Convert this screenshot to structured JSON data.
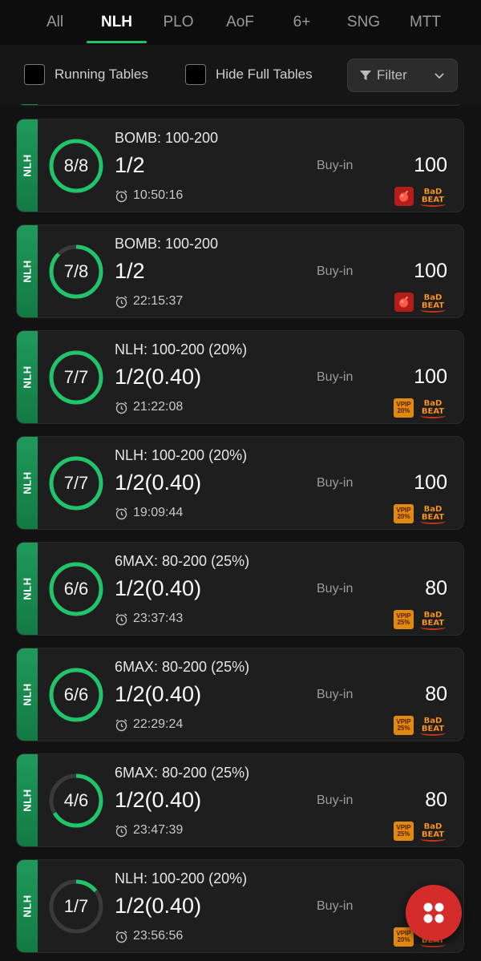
{
  "tabs": [
    {
      "label": "All"
    },
    {
      "label": "NLH"
    },
    {
      "label": "PLO"
    },
    {
      "label": "AoF"
    },
    {
      "label": "6+"
    },
    {
      "label": "SNG"
    },
    {
      "label": "MTT"
    }
  ],
  "active_tab": "NLH",
  "filters": {
    "running_tables_label": "Running Tables",
    "hide_full_label": "Hide Full Tables",
    "filter_label": "Filter"
  },
  "tables": [
    {
      "type": "NLH",
      "seats": "8/8",
      "filled": 8,
      "max": 8,
      "name": "BOMB: 100-200",
      "stakes": "1/2",
      "time": "10:50:16",
      "buyin_label": "Buy-in",
      "buyin": "100",
      "badges": [
        "bomb",
        "badbeat"
      ]
    },
    {
      "type": "NLH",
      "seats": "7/8",
      "filled": 7,
      "max": 8,
      "name": "BOMB: 100-200",
      "stakes": "1/2",
      "time": "22:15:37",
      "buyin_label": "Buy-in",
      "buyin": "100",
      "badges": [
        "bomb",
        "badbeat"
      ]
    },
    {
      "type": "NLH",
      "seats": "7/7",
      "filled": 7,
      "max": 7,
      "name": "NLH: 100-200 (20%)",
      "stakes": "1/2(0.40)",
      "time": "21:22:08",
      "buyin_label": "Buy-in",
      "buyin": "100",
      "badges": [
        "vpip20",
        "badbeat"
      ]
    },
    {
      "type": "NLH",
      "seats": "7/7",
      "filled": 7,
      "max": 7,
      "name": "NLH: 100-200 (20%)",
      "stakes": "1/2(0.40)",
      "time": "19:09:44",
      "buyin_label": "Buy-in",
      "buyin": "100",
      "badges": [
        "vpip20",
        "badbeat"
      ]
    },
    {
      "type": "NLH",
      "seats": "6/6",
      "filled": 6,
      "max": 6,
      "name": "6MAX: 80-200 (25%)",
      "stakes": "1/2(0.40)",
      "time": "23:37:43",
      "buyin_label": "Buy-in",
      "buyin": "80",
      "badges": [
        "vpip25",
        "badbeat"
      ]
    },
    {
      "type": "NLH",
      "seats": "6/6",
      "filled": 6,
      "max": 6,
      "name": "6MAX: 80-200 (25%)",
      "stakes": "1/2(0.40)",
      "time": "22:29:24",
      "buyin_label": "Buy-in",
      "buyin": "80",
      "badges": [
        "vpip25",
        "badbeat"
      ]
    },
    {
      "type": "NLH",
      "seats": "4/6",
      "filled": 4,
      "max": 6,
      "name": "6MAX: 80-200 (25%)",
      "stakes": "1/2(0.40)",
      "time": "23:47:39",
      "buyin_label": "Buy-in",
      "buyin": "80",
      "badges": [
        "vpip25",
        "badbeat"
      ]
    },
    {
      "type": "NLH",
      "seats": "1/7",
      "filled": 1,
      "max": 7,
      "name": "NLH: 100-200 (20%)",
      "stakes": "1/2(0.40)",
      "time": "23:56:56",
      "buyin_label": "Buy-in",
      "buyin": "",
      "badges": [
        "vpip20",
        "badbeat"
      ]
    }
  ],
  "badge_text": {
    "vpip": "VPIP",
    "vpip20": "20%",
    "vpip25": "25%",
    "badbeat_1": "BaD",
    "badbeat_2": "BEAT"
  },
  "colors": {
    "accent": "#21c46a",
    "ring_track": "#3a3a3a",
    "fab": "#d42b2b"
  },
  "icons": {
    "filter": "filter-funnel-icon",
    "clock": "alarm-clock-icon",
    "fab": "menu-dots-icon"
  }
}
